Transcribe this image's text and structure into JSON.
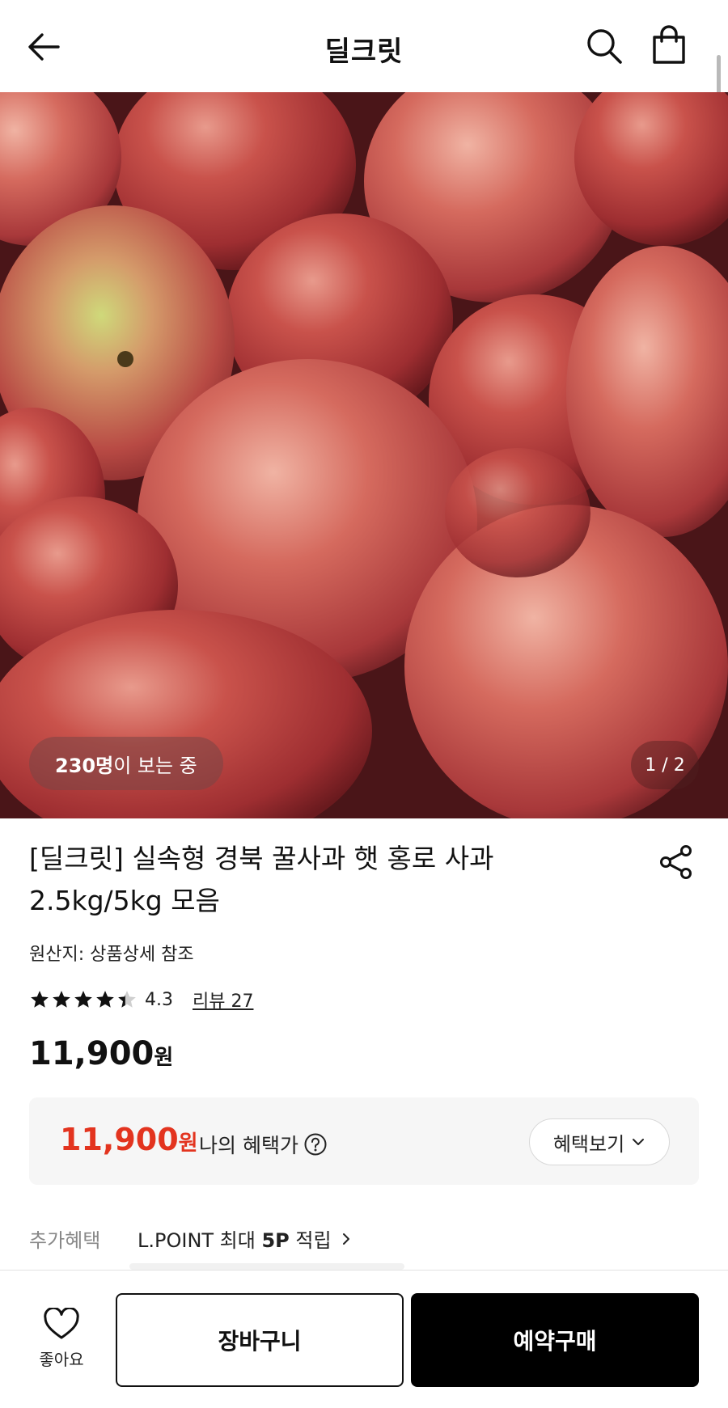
{
  "header": {
    "title": "딜크릿",
    "back_icon": "arrow-left-icon",
    "search_icon": "search-icon",
    "cart_icon": "shopping-bag-icon"
  },
  "hero": {
    "viewers_count": "230명",
    "viewers_suffix": "이 보는 중",
    "pager": "1 / 2"
  },
  "product": {
    "title_line1": "[딜크릿] 실속형 경북 꿀사과 햇 홍로 사과",
    "title_line2": "2.5kg/5kg 모음",
    "origin": "원산지: 상품상세 참조",
    "rating": "4.3",
    "rating_value": 4.3,
    "review_link": "리뷰 27",
    "price": "11,900",
    "price_unit": "원"
  },
  "benefit": {
    "price": "11,900",
    "price_unit": "원",
    "label": "나의 혜택가",
    "button": "혜택보기",
    "accent_color": "#e3341f"
  },
  "extra": {
    "label": "추가혜택",
    "text_prefix": "L.POINT 최대 ",
    "text_bold": "5P",
    "text_suffix": " 적립"
  },
  "bottom": {
    "like_label": "좋아요",
    "cart_button": "장바구니",
    "buy_button": "예약구매"
  }
}
